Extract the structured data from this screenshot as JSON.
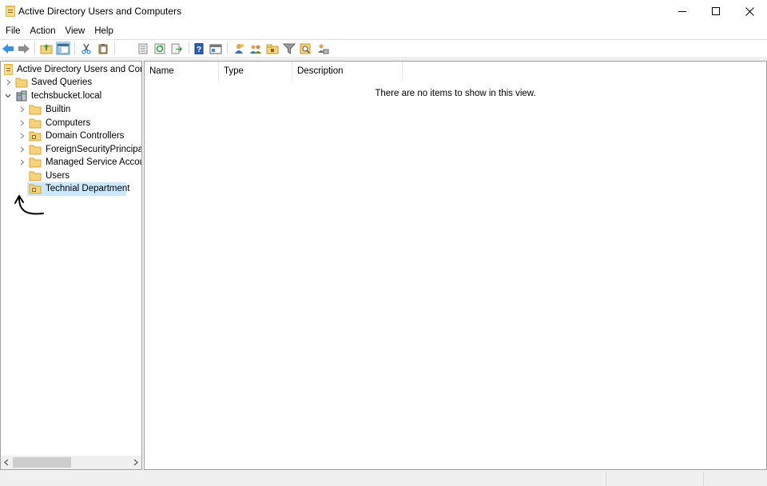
{
  "window": {
    "title": "Active Directory Users and Computers",
    "app_icon": "folder-icon",
    "controls": [
      "minimize-icon",
      "maximize-icon",
      "close-icon"
    ]
  },
  "menu": {
    "items": [
      "File",
      "Action",
      "View",
      "Help"
    ]
  },
  "toolbar": {
    "buttons": [
      "back-icon",
      "forward-icon",
      "up-folder-icon",
      "show-hide-console-tree-icon",
      "cut-icon",
      "paste-icon",
      "properties-icon",
      "refresh-icon",
      "export-list-icon",
      "help-icon",
      "mmc-pane-icon",
      "new-user-icon",
      "new-group-icon",
      "new-ou-icon",
      "filter-icon",
      "find-icon",
      "add-to-group-icon"
    ]
  },
  "tree": {
    "root": "Active Directory Users and Comp",
    "saved_queries": "Saved Queries",
    "domain": "techsbucket.local",
    "children": [
      "Builtin",
      "Computers",
      "Domain Controllers",
      "ForeignSecurityPrincipals",
      "Managed Service Accoun",
      "Users",
      "Technial Department"
    ],
    "selected": "Technial Department"
  },
  "list": {
    "columns": [
      "Name",
      "Type",
      "Description"
    ],
    "empty_message": "There are no items to show in this view."
  },
  "colors": {
    "selection": "#cce8ff",
    "folder": "#f6d27a",
    "accent_blue": "#3a8ee6"
  }
}
